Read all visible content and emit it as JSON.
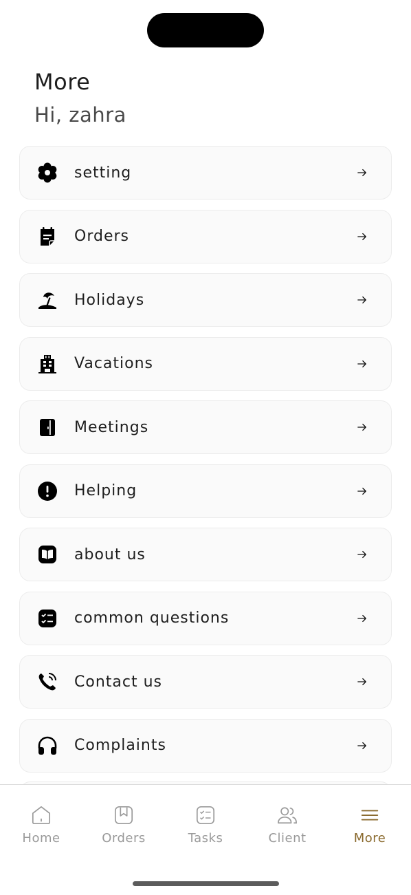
{
  "header": {
    "title": "More",
    "greeting": "Hi, zahra"
  },
  "menu": {
    "items": [
      {
        "label": "setting",
        "icon": "gear-icon"
      },
      {
        "label": "Orders",
        "icon": "notepad-icon"
      },
      {
        "label": "Holidays",
        "icon": "beach-umbrella-icon"
      },
      {
        "label": "Vacations",
        "icon": "hotel-building-icon"
      },
      {
        "label": "Meetings",
        "icon": "door-icon"
      },
      {
        "label": "Helping",
        "icon": "exclamation-circle-icon"
      },
      {
        "label": "about us",
        "icon": "book-icon"
      },
      {
        "label": "common questions",
        "icon": "checklist-icon"
      },
      {
        "label": "Contact us",
        "icon": "phone-call-icon"
      },
      {
        "label": "Complaints",
        "icon": "headphones-icon"
      }
    ]
  },
  "tabbar": {
    "tabs": [
      {
        "label": "Home",
        "icon": "home-icon",
        "active": false
      },
      {
        "label": "Orders",
        "icon": "bookmark-icon",
        "active": false
      },
      {
        "label": "Tasks",
        "icon": "task-list-icon",
        "active": false
      },
      {
        "label": "Client",
        "icon": "users-icon",
        "active": false
      },
      {
        "label": "More",
        "icon": "hamburger-menu-icon",
        "active": true
      }
    ]
  },
  "colors": {
    "accent": "#8a6a2e",
    "inactive": "#9a9a9a",
    "card": "#fafafa"
  }
}
